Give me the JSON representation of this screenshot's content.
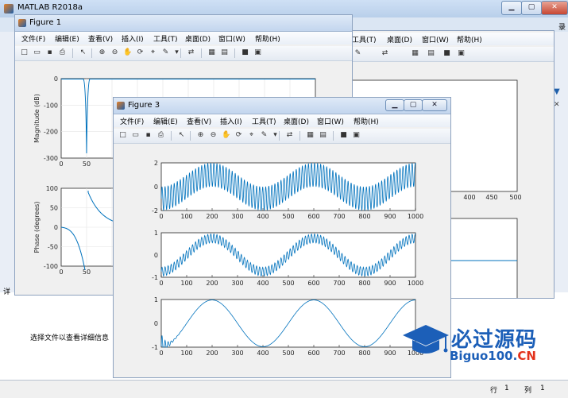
{
  "app": {
    "title": "MATLAB R2018a",
    "right_edge_label": "录",
    "info_text": "选择文件以查看详细信息"
  },
  "status": {
    "row_label": "行",
    "row_value": "1",
    "col_label": "列",
    "col_value": "1"
  },
  "menu": [
    "文件(F)",
    "编辑(E)",
    "查看(V)",
    "插入(I)",
    "工具(T)",
    "桌面(D)",
    "窗口(W)",
    "帮助(H)"
  ],
  "back_menu": [
    "工具(T)",
    "桌面(D)",
    "窗口(W)",
    "帮助(H)"
  ],
  "figure1": {
    "title": "Figure 1",
    "magnitude": {
      "ylabel": "Magnitude (dB)",
      "yticks": [
        "0",
        "-100",
        "-200",
        "-300"
      ],
      "xticks": [
        "0",
        "50"
      ]
    },
    "phase": {
      "ylabel": "Phase (degrees)",
      "yticks": [
        "100",
        "50",
        "0",
        "-50",
        "-100"
      ],
      "xticks": [
        "0",
        "50"
      ]
    }
  },
  "figure_back": {
    "xticks": [
      "400",
      "450",
      "500"
    ]
  },
  "figure3": {
    "title": "Figure 3",
    "xticks": [
      "0",
      "100",
      "200",
      "300",
      "400",
      "500",
      "600",
      "700",
      "800",
      "900",
      "1000"
    ]
  },
  "chart_data": [
    {
      "type": "line",
      "name": "Figure 3 subplot 1",
      "xlim": [
        0,
        1000
      ],
      "ylim": [
        -2,
        2
      ],
      "yticks": [
        "2",
        "0",
        "-2"
      ],
      "description_formula": "sin(2*pi*t/400) + sin(2*pi*t/12)",
      "low_period": 400,
      "high_period": 12,
      "low_amp": 1,
      "high_amp": 1,
      "decay": 0
    },
    {
      "type": "line",
      "name": "Figure 3 subplot 2",
      "xlim": [
        0,
        1000
      ],
      "ylim": [
        -1,
        1
      ],
      "yticks": [
        "1",
        "0",
        "-1"
      ],
      "low_period": 400,
      "high_period": 12,
      "low_amp": 0.75,
      "high_amp": 0.2,
      "decay": 0
    },
    {
      "type": "line",
      "name": "Figure 3 subplot 3",
      "xlim": [
        0,
        1000
      ],
      "ylim": [
        -1,
        1
      ],
      "yticks": [
        "1",
        "0",
        "-1"
      ],
      "low_period": 400,
      "high_period": 12,
      "low_amp": 1,
      "high_amp": 0.55,
      "decay": 18
    }
  ],
  "watermark": {
    "text": "必过源码",
    "url_main": "Biguo100.",
    "url_cn": "CN"
  },
  "colors": {
    "line": "#0072bd",
    "axes_bg": "#ffffff",
    "figure_bg": "#f0f0f0",
    "title_bg": "#c3d6ee"
  }
}
